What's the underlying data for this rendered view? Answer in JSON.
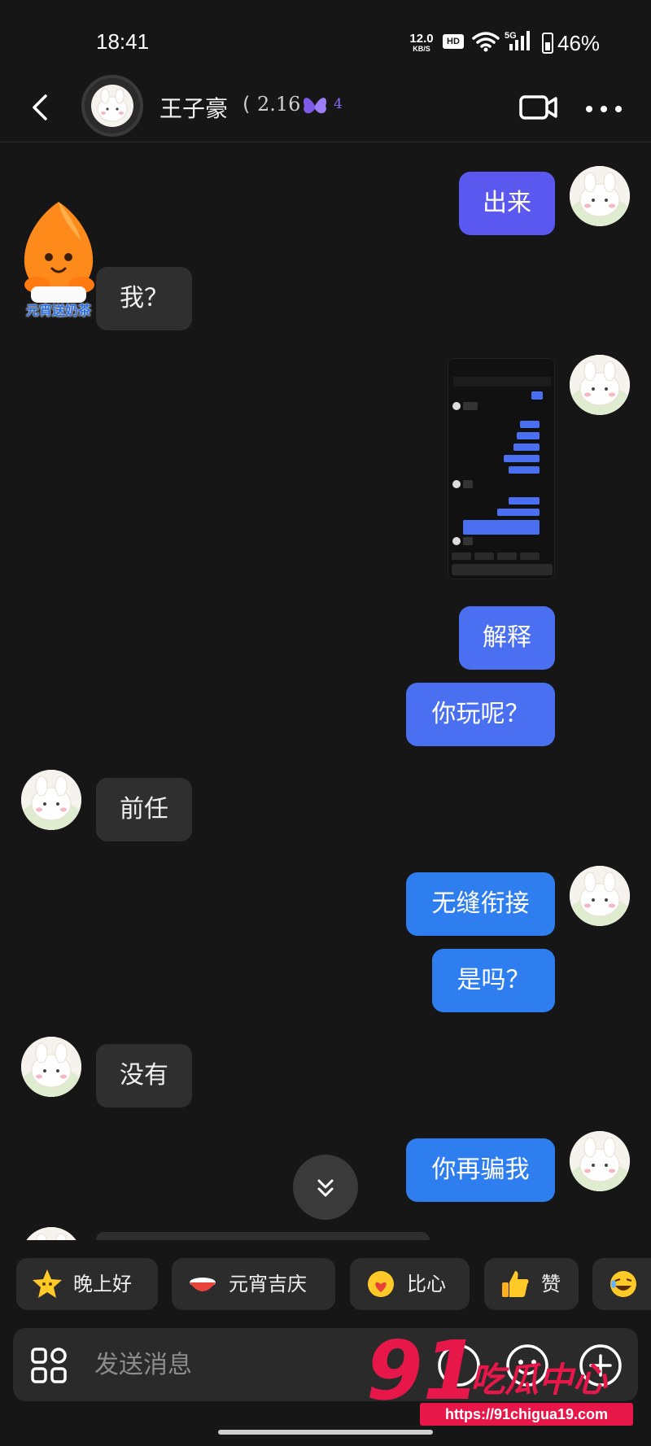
{
  "status_bar": {
    "time": "18:41",
    "net_speed": "12.0",
    "net_unit": "KB/S",
    "hd": "HD",
    "network": "5G",
    "battery": "46%"
  },
  "header": {
    "contact_name": "王子豪",
    "paren": "(",
    "level": "2.16",
    "badge_count": "4"
  },
  "messages": [
    {
      "side": "out",
      "text": "出来"
    },
    {
      "side": "in",
      "text": "我？",
      "sticker_label": "元宵送奶茶"
    },
    {
      "side": "out",
      "type": "image"
    },
    {
      "side": "out",
      "text": "解释"
    },
    {
      "side": "out",
      "text": "你玩呢？"
    },
    {
      "side": "in",
      "text": "前任"
    },
    {
      "side": "out",
      "text": "无缝衔接"
    },
    {
      "side": "out",
      "text": "是吗？"
    },
    {
      "side": "in",
      "text": "没有"
    },
    {
      "side": "out",
      "text": "你再骗我"
    }
  ],
  "quick_replies": [
    {
      "label": "晚上好",
      "icon": "star-face-icon"
    },
    {
      "label": "元宵吉庆",
      "icon": "bowl-icon"
    },
    {
      "label": "比心",
      "icon": "heart-hands-icon"
    },
    {
      "label": "赞",
      "icon": "thumbs-up-icon"
    },
    {
      "label": "",
      "icon": "laughing-face-icon"
    }
  ],
  "input": {
    "placeholder": "发送消息"
  },
  "watermark": {
    "number": "91",
    "brand": "吃瓜中心",
    "url": "https://91chigua19.com"
  },
  "colors": {
    "background": "#161616",
    "incoming_bubble": "#2f2f2f",
    "outgoing_bubble": "#4a6ff0",
    "watermark": "#e8174a"
  }
}
